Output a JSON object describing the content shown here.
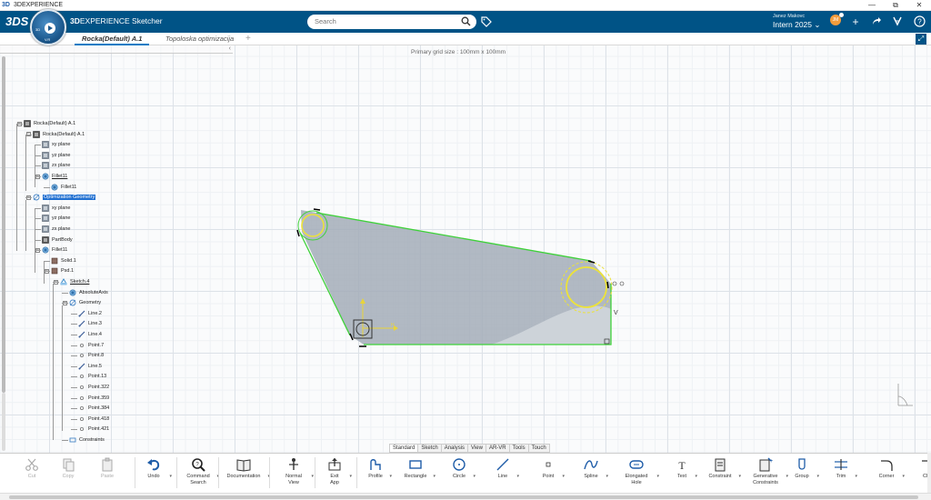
{
  "window": {
    "title": "3DEXPERIENCE",
    "controls": [
      "—",
      "⧉",
      "✕"
    ]
  },
  "topbar": {
    "logo": "3DS",
    "app_prefix": "3D",
    "app_name": "EXPERIENCE Sketcher",
    "search_placeholder": "Search",
    "user_name": "Janez Makovc",
    "context": "Intern 2025 ⌄",
    "avatar_initials": "JM"
  },
  "compass": {
    "version": "V.R",
    "label_left": "3D",
    "label_right": "V.R"
  },
  "tabs": [
    {
      "label": "Rocka(Default) A.1",
      "active": true
    },
    {
      "label": "Topoloska optimizacija",
      "active": false
    }
  ],
  "add_tab": "+",
  "canvas": {
    "grid_info": "Primary grid size : 100mm x 100mm",
    "constraint_label": "V"
  },
  "tree": [
    {
      "label": "Rocka(Default) A.1",
      "depth": 0
    },
    {
      "label": "Rocka(Default) A.1",
      "depth": 1
    },
    {
      "label": "xy plane",
      "depth": 2
    },
    {
      "label": "yz plane",
      "depth": 2
    },
    {
      "label": "zx plane",
      "depth": 2
    },
    {
      "label": "Fillet11",
      "depth": 2
    },
    {
      "label": "Fillet11",
      "depth": 3
    },
    {
      "label": "Optimization Geometry",
      "depth": 1
    },
    {
      "label": "xy plane",
      "depth": 2
    },
    {
      "label": "yz plane",
      "depth": 2
    },
    {
      "label": "zx plane",
      "depth": 2
    },
    {
      "label": "PartBody",
      "depth": 2
    },
    {
      "label": "Fillet11",
      "depth": 2
    },
    {
      "label": "Solid.1",
      "depth": 3
    },
    {
      "label": "Psd.1",
      "depth": 3
    },
    {
      "label": "Sketch.4",
      "depth": 4
    },
    {
      "label": "AbsoluteAxis",
      "depth": 5
    },
    {
      "label": "Geometry",
      "depth": 5
    },
    {
      "label": "Line.2",
      "depth": 6
    },
    {
      "label": "Line.3",
      "depth": 6
    },
    {
      "label": "Line.4",
      "depth": 6
    },
    {
      "label": "Point.7",
      "depth": 6
    },
    {
      "label": "Point.8",
      "depth": 6
    },
    {
      "label": "Line.5",
      "depth": 6
    },
    {
      "label": "Point.13",
      "depth": 6
    },
    {
      "label": "Point.322",
      "depth": 6
    },
    {
      "label": "Point.359",
      "depth": 6
    },
    {
      "label": "Point.384",
      "depth": 6
    },
    {
      "label": "Point.418",
      "depth": 6
    },
    {
      "label": "Point.421",
      "depth": 6
    },
    {
      "label": "Constraints",
      "depth": 5
    }
  ],
  "bottom_tabs": [
    "Standard",
    "Sketch",
    "Analysis",
    "View",
    "AR-VR",
    "Tools",
    "Touch"
  ],
  "toolbar": [
    {
      "label": "Cut",
      "icon": "scissors-icon",
      "enabled": false
    },
    {
      "label": "Copy",
      "icon": "copy-icon",
      "enabled": false
    },
    {
      "label": "Paste",
      "icon": "paste-icon",
      "enabled": false
    },
    {
      "label": "Undo",
      "icon": "undo-icon",
      "enabled": true
    },
    {
      "label": "Command\nSearch",
      "icon": "command-search-icon",
      "enabled": true
    },
    {
      "label": "Documentation",
      "icon": "book-icon",
      "enabled": true
    },
    {
      "label": "Normal\nView",
      "icon": "normal-view-icon",
      "enabled": true
    },
    {
      "label": "Exit\nApp",
      "icon": "exit-icon",
      "enabled": true
    },
    {
      "label": "Profile",
      "icon": "profile-icon",
      "enabled": true
    },
    {
      "label": "Rectangle",
      "icon": "rectangle-icon",
      "enabled": true
    },
    {
      "label": "Circle",
      "icon": "circle-icon",
      "enabled": true
    },
    {
      "label": "Line",
      "icon": "line-icon",
      "enabled": true
    },
    {
      "label": "Point",
      "icon": "point-icon",
      "enabled": true
    },
    {
      "label": "Spline",
      "icon": "spline-icon",
      "enabled": true
    },
    {
      "label": "Elongated\nHole",
      "icon": "elongated-hole-icon",
      "enabled": true
    },
    {
      "label": "Text",
      "icon": "text-icon",
      "enabled": true
    },
    {
      "label": "Constraint",
      "icon": "constraint-icon",
      "enabled": true
    },
    {
      "label": "Generative\nConstraints",
      "icon": "generative-constraints-icon",
      "enabled": true
    },
    {
      "label": "Group",
      "icon": "group-icon",
      "enabled": true
    },
    {
      "label": "Trim",
      "icon": "trim-icon",
      "enabled": true
    },
    {
      "label": "Corner",
      "icon": "corner-icon",
      "enabled": true
    },
    {
      "label": "Cha",
      "icon": "chamfer-icon",
      "enabled": true
    }
  ],
  "colors": {
    "brand": "#005386",
    "accent": "#0a7bc4",
    "profile": "#4cd83a",
    "fillet": "#e8e23a",
    "selection": "#1f6fd1"
  }
}
